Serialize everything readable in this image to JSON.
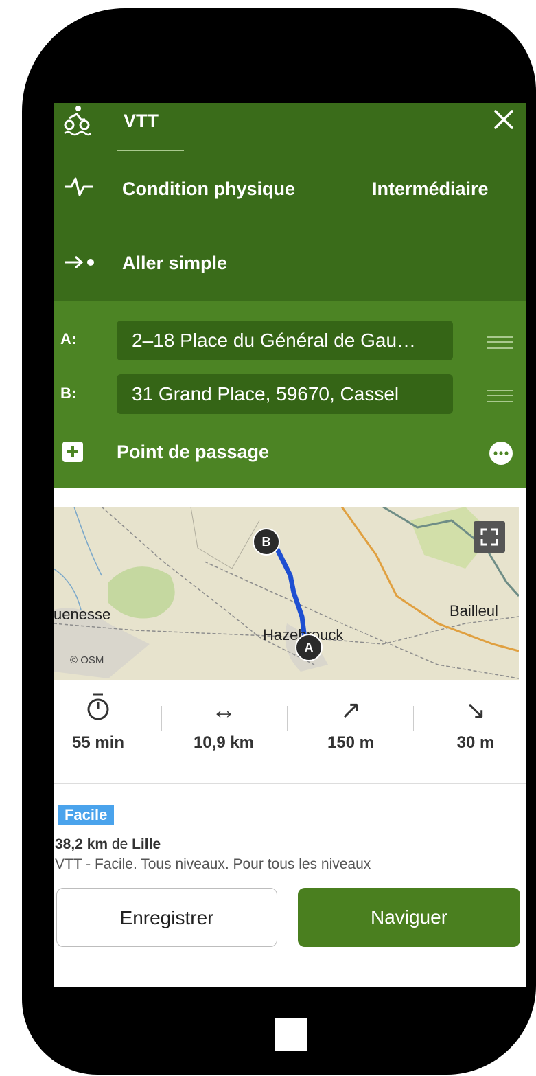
{
  "activity": {
    "label": "VTT"
  },
  "fitness": {
    "label": "Condition physique",
    "value": "Intermédiaire"
  },
  "trip": {
    "label": "Aller simple"
  },
  "route": {
    "a_label": "A:",
    "a_value": "2–18 Place du Général de Gau…",
    "b_label": "B:",
    "b_value": "31 Grand Place, 59670, Cassel",
    "add_waypoint": "Point de passage"
  },
  "map": {
    "labels": {
      "left": "uenesse",
      "center": "Hazebrouck",
      "right": "Bailleul"
    },
    "attribution": "© OSM",
    "marker_a": "A",
    "marker_b": "B"
  },
  "stats": {
    "duration": "55 min",
    "distance": "10,9 km",
    "ascent": "150 m",
    "descent": "30 m"
  },
  "suggestion": {
    "badge": "Facile",
    "distance": "38,2 km",
    "from_word": "de",
    "city": "Lille",
    "description": "VTT - Facile, Tous niveaux, Pour tous les niveaux"
  },
  "actions": {
    "save": "Enregistrer",
    "navigate": "Naviguer"
  },
  "colors": {
    "header_green": "#3a6c1a",
    "panel_green": "#4c8424",
    "button_green": "#4a7f1f",
    "badge_blue": "#4aa3ec",
    "route_blue": "#1e4fd1"
  }
}
